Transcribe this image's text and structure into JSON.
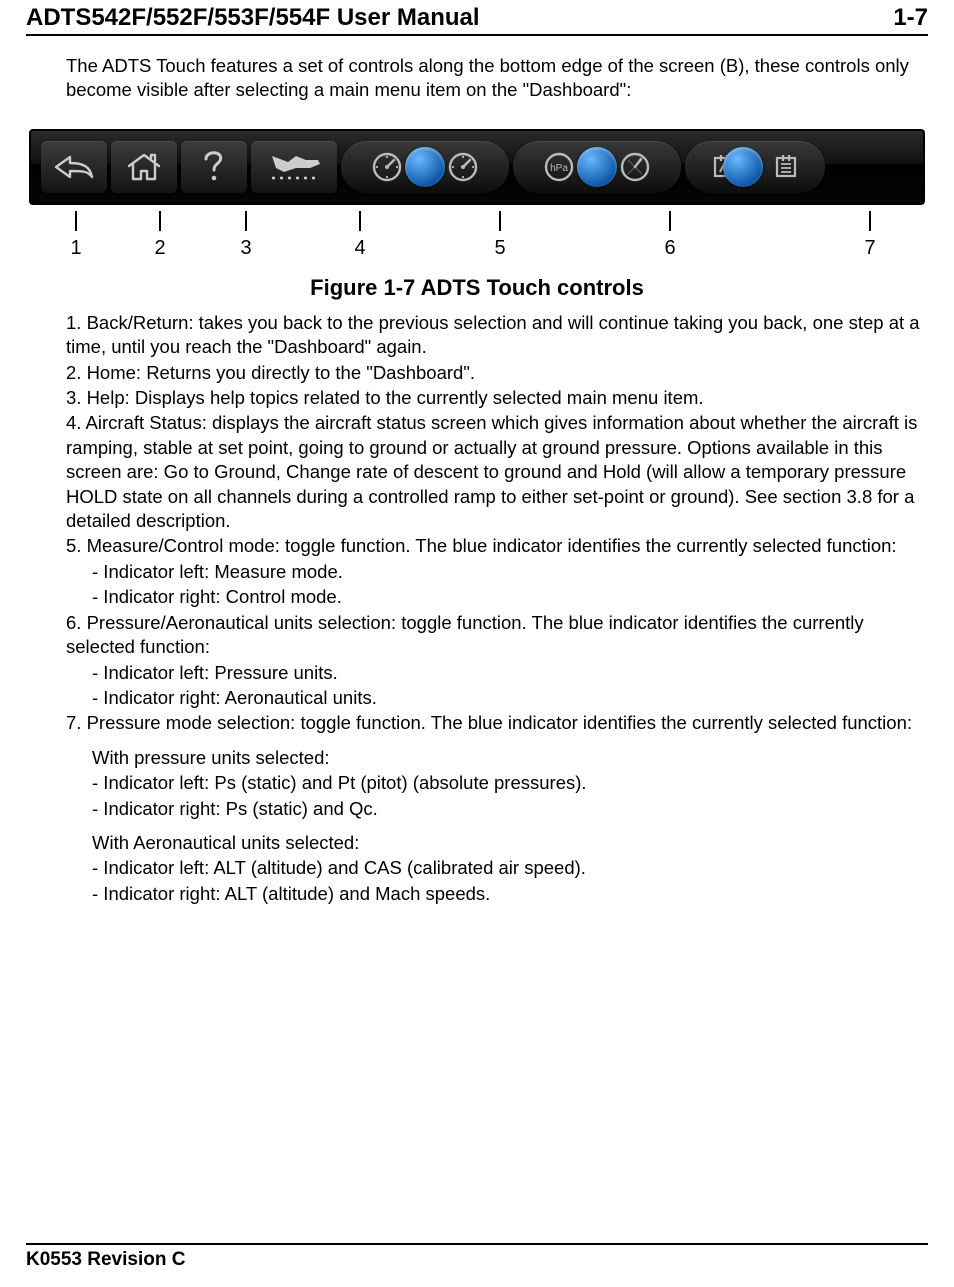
{
  "header": {
    "title": "ADTS542F/552F/553F/554F User Manual",
    "page": "1-7"
  },
  "intro": "The ADTS Touch features a set of controls along the bottom edge of the screen (B), these controls only become visible after selecting a main menu item on the \"Dashboard\":",
  "toolbar": {
    "callouts": [
      "1",
      "2",
      "3",
      "4",
      "5",
      "6",
      "7"
    ]
  },
  "figure_title": "Figure 1-7 ADTS Touch controls",
  "items": {
    "i1": "1. Back/Return: takes you back to the previous selection and will continue taking you back, one step at a time, until you reach the \"Dashboard\" again.",
    "i2": "2. Home: Returns you directly to the \"Dashboard\".",
    "i3": "3. Help: Displays help topics related to the currently selected main menu item.",
    "i4": "4. Aircraft Status: displays the aircraft status screen which gives information about whether the aircraft is ramping, stable at set point, going to ground or actually at ground pressure. Options available in this screen are: Go to Ground, Change rate of descent to ground and Hold (will allow a temporary pressure HOLD state on all channels during a controlled ramp to either set-point or ground). See section 3.8 for a detailed description.",
    "i5": "5. Measure/Control mode: toggle function. The blue indicator identifies the currently selected function:",
    "i5a": "- Indicator left: Measure mode.",
    "i5b": "- Indicator right: Control mode.",
    "i6": "6. Pressure/Aeronautical units selection: toggle function. The blue indicator identifies the currently selected function:",
    "i6a": "- Indicator left: Pressure units.",
    "i6b": "- Indicator right: Aeronautical units.",
    "i7": "7. Pressure mode selection: toggle function. The blue indicator identifies the currently selected function:",
    "i7p": "With pressure units selected:",
    "i7pa": "- Indicator left: Ps (static) and Pt (pitot) (absolute pressures).",
    "i7pb": "- Indicator right: Ps (static) and Qc.",
    "i7a": "With Aeronautical units selected:",
    "i7aa": "- Indicator left: ALT (altitude) and CAS (calibrated air speed).",
    "i7ab": "- Indicator right: ALT (altitude) and Mach speeds."
  },
  "footer": "K0553 Revision C"
}
